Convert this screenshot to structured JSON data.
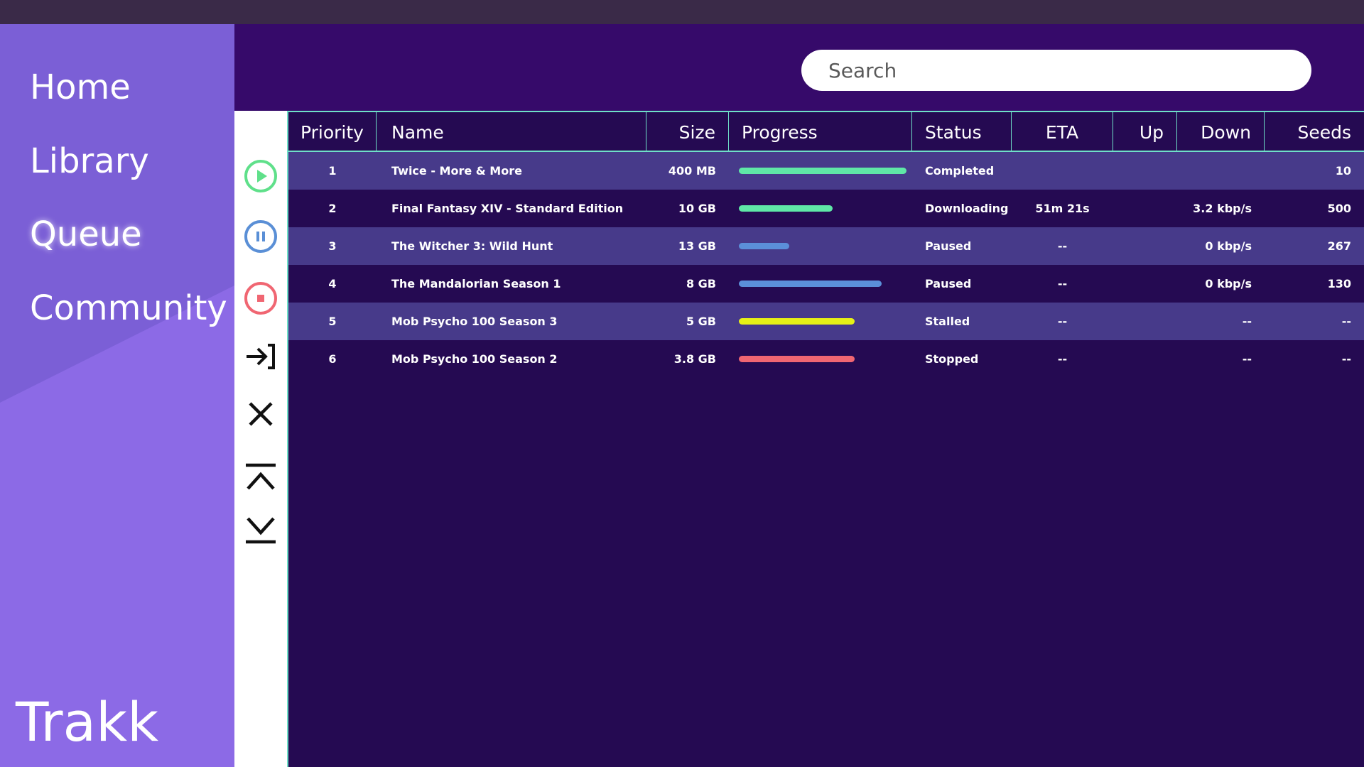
{
  "window": {
    "title_bar_color": "#3a2a48"
  },
  "sidebar": {
    "bg_color": "#8c6ae6",
    "items": [
      {
        "label": "Home"
      },
      {
        "label": "Library"
      },
      {
        "label": "Queue",
        "active": true
      },
      {
        "label": "Community"
      }
    ],
    "brand": "Trakk"
  },
  "search": {
    "placeholder": "Search",
    "value": ""
  },
  "toolbar": {
    "tools": [
      {
        "icon": "play-circle-icon",
        "color": "#5fe08a"
      },
      {
        "icon": "pause-circle-icon",
        "color": "#5a8fd6"
      },
      {
        "icon": "stop-circle-icon",
        "color": "#f06672"
      },
      {
        "icon": "move-to-icon",
        "color": "#111111"
      },
      {
        "icon": "close-icon",
        "color": "#111111"
      },
      {
        "icon": "move-to-top-icon",
        "color": "#111111"
      },
      {
        "icon": "move-to-bottom-icon",
        "color": "#111111"
      }
    ]
  },
  "table": {
    "columns": [
      "Priority",
      "Name",
      "Size",
      "Progress",
      "Status",
      "ETA",
      "Up",
      "Down",
      "Seeds"
    ],
    "rows": [
      {
        "priority": "1",
        "name": "Twice - More & More",
        "size": "400 MB",
        "progress": 1.0,
        "progress_color": "#5fe7a7",
        "status": "Completed",
        "eta": "",
        "up": "",
        "down": "",
        "seeds": "10"
      },
      {
        "priority": "2",
        "name": "Final Fantasy XIV - Standard Edition",
        "size": "10 GB",
        "progress": 0.56,
        "progress_color": "#5fe7a7",
        "status": "Downloading",
        "eta": "51m 21s",
        "up": "",
        "down": "3.2 kbp/s",
        "seeds": "500"
      },
      {
        "priority": "3",
        "name": "The Witcher 3: Wild Hunt",
        "size": "13 GB",
        "progress": 0.3,
        "progress_color": "#5b8fd9",
        "status": "Paused",
        "eta": "--",
        "up": "",
        "down": "0 kbp/s",
        "seeds": "267"
      },
      {
        "priority": "4",
        "name": "The Mandalorian Season 1",
        "size": "8 GB",
        "progress": 0.85,
        "progress_color": "#5b8fd9",
        "status": "Paused",
        "eta": "--",
        "up": "",
        "down": "0 kbp/s",
        "seeds": "130"
      },
      {
        "priority": "5",
        "name": "Mob Psycho 100 Season 3",
        "size": "5 GB",
        "progress": 0.69,
        "progress_color": "#e6f016",
        "status": "Stalled",
        "eta": "--",
        "up": "",
        "down": "--",
        "seeds": "--"
      },
      {
        "priority": "6",
        "name": "Mob Psycho 100 Season 2",
        "size": "3.8 GB",
        "progress": 0.69,
        "progress_color": "#f06672",
        "status": "Stopped",
        "eta": "--",
        "up": "",
        "down": "--",
        "seeds": "--"
      }
    ]
  },
  "colors": {
    "header_bg": "#360a6a",
    "table_bg": "#250a52",
    "row_alt_bg": "#473a8a",
    "grid_line": "#6fe0c8"
  }
}
